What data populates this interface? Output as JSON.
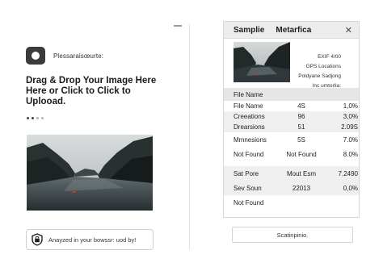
{
  "left": {
    "app_name": "Plessaraisœurte:",
    "icon": "camera-icon",
    "drop_text": "Drag & Drop Your Image Here Here or Click to Click to Uplooad.",
    "analysis_text": "Anayzed in your bowssr: uod by!"
  },
  "right": {
    "title": "Samplie",
    "title2": "Metarfica",
    "close_label": "✕",
    "meta": [
      "EXIF 4/00",
      "GPS Locations",
      "Poldyane Sadjong",
      "Inc umtorlia:"
    ],
    "header": "File Name",
    "rows": [
      {
        "c1": "File Name",
        "c2": "4S",
        "c3": "1,0%"
      },
      {
        "c1": "Creeations",
        "c2": "96",
        "c3": "3,0%"
      },
      {
        "c1": "Drearsions",
        "c2": "51",
        "c3": "2.09S"
      },
      {
        "c1": "Mmnesions",
        "c2": "5S",
        "c3": "7.0%"
      },
      {
        "c1": "Not Found",
        "c2": "Not Found",
        "c3": "8.0%"
      },
      {
        "c1": "Sat Pore",
        "c2": "Mout Esm",
        "c3": "7.2490"
      },
      {
        "c1": "Sev Soun",
        "c2": "22013",
        "c3": "0,0%"
      },
      {
        "c1": "Not Found",
        "c2": "",
        "c3": ""
      }
    ],
    "button_label": "Scatinpinio."
  }
}
